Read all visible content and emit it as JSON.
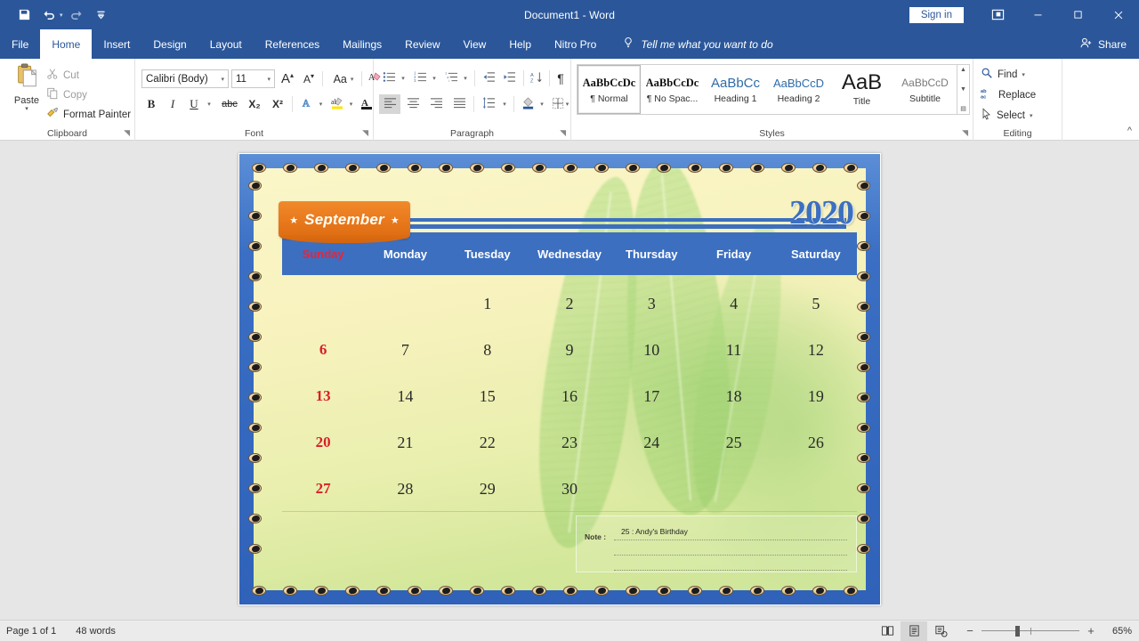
{
  "window": {
    "title": "Document1  -  Word",
    "signin_label": "Sign in",
    "share_label": "Share",
    "ribbon_display_icon": "ribbon-display-options-icon",
    "minimize_icon": "minimize-icon",
    "maximize_icon": "maximize-icon",
    "close_icon": "close-icon"
  },
  "quick_access": {
    "save_icon": "save-icon",
    "undo_icon": "undo-icon",
    "redo_icon": "redo-icon",
    "customize_icon": "customize-quick-access-icon"
  },
  "tabs": [
    {
      "label": "File",
      "active": false
    },
    {
      "label": "Home",
      "active": true
    },
    {
      "label": "Insert",
      "active": false
    },
    {
      "label": "Design",
      "active": false
    },
    {
      "label": "Layout",
      "active": false
    },
    {
      "label": "References",
      "active": false
    },
    {
      "label": "Mailings",
      "active": false
    },
    {
      "label": "Review",
      "active": false
    },
    {
      "label": "View",
      "active": false
    },
    {
      "label": "Help",
      "active": false
    },
    {
      "label": "Nitro Pro",
      "active": false
    }
  ],
  "tell_me": {
    "icon": "lightbulb-icon",
    "placeholder": "Tell me what you want to do"
  },
  "ribbon": {
    "clipboard": {
      "group_label": "Clipboard",
      "paste_label": "Paste",
      "cut_label": "Cut",
      "copy_label": "Copy",
      "format_painter_label": "Format Painter"
    },
    "font": {
      "group_label": "Font",
      "font_name": "Calibri (Body)",
      "font_size": "11",
      "grow_font": "A",
      "shrink_font": "A",
      "change_case": "Aa",
      "bold": "B",
      "italic": "I",
      "underline": "U",
      "strikethrough": "abc",
      "subscript": "X₂",
      "superscript": "X²",
      "text_effects": "A",
      "highlight": "ab",
      "font_color": "A"
    },
    "paragraph": {
      "group_label": "Paragraph"
    },
    "styles": {
      "group_label": "Styles",
      "items": [
        {
          "preview": "AaBbCcDc",
          "name": "¶ Normal",
          "selected": true
        },
        {
          "preview": "AaBbCcDc",
          "name": "¶ No Spac...",
          "selected": false
        },
        {
          "preview": "AaBbCc",
          "name": "Heading 1",
          "selected": false
        },
        {
          "preview": "AaBbCcD",
          "name": "Heading 2",
          "selected": false
        },
        {
          "preview": "AaB",
          "name": "Title",
          "selected": false
        },
        {
          "preview": "AaBbCcD",
          "name": "Subtitle",
          "selected": false
        }
      ]
    },
    "editing": {
      "group_label": "Editing",
      "find_label": "Find",
      "replace_label": "Replace",
      "select_label": "Select"
    }
  },
  "document": {
    "calendar": {
      "month": "September",
      "year": "2020",
      "day_names": [
        "Sunday",
        "Monday",
        "Tuesday",
        "Wednesday",
        "Thursday",
        "Friday",
        "Saturday"
      ],
      "weeks": [
        [
          "",
          "",
          "1",
          "2",
          "3",
          "4",
          "5"
        ],
        [
          "6",
          "7",
          "8",
          "9",
          "10",
          "11",
          "12"
        ],
        [
          "13",
          "14",
          "15",
          "16",
          "17",
          "18",
          "19"
        ],
        [
          "20",
          "21",
          "22",
          "23",
          "24",
          "25",
          "26"
        ],
        [
          "27",
          "28",
          "29",
          "30",
          "",
          "",
          ""
        ]
      ],
      "note_label": "Note :",
      "note_text": "25 : Andy's Birthday",
      "colors": {
        "header_blue": "#3c6fc0",
        "banner_orange": "#e8781c",
        "sunday_red": "#d81f2a",
        "page_yellow": "#fbf6c8",
        "page_green": "#cfe69b"
      }
    }
  },
  "status_bar": {
    "page_label": "Page 1 of 1",
    "word_count": "48 words",
    "read_mode_icon": "read-mode-icon",
    "print_layout_icon": "print-layout-icon",
    "web_layout_icon": "web-layout-icon",
    "zoom_out": "−",
    "zoom_in": "+",
    "zoom_level": "65%"
  }
}
